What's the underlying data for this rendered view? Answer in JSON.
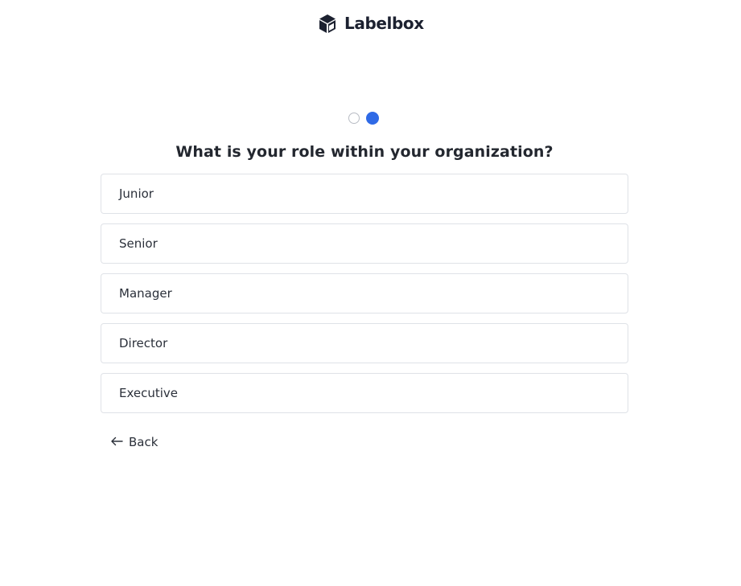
{
  "brand": {
    "name": "Labelbox",
    "logo_icon": "labelbox-cube-icon",
    "logo_color": "#1c2130"
  },
  "progress": {
    "total_steps": 2,
    "current_step": 2,
    "active_color": "#2f6ae6"
  },
  "question": "What is your role within your organization?",
  "options": [
    {
      "label": "Junior"
    },
    {
      "label": "Senior"
    },
    {
      "label": "Manager"
    },
    {
      "label": "Director"
    },
    {
      "label": "Executive"
    }
  ],
  "back": {
    "label": "Back",
    "icon": "arrow-left-icon"
  }
}
